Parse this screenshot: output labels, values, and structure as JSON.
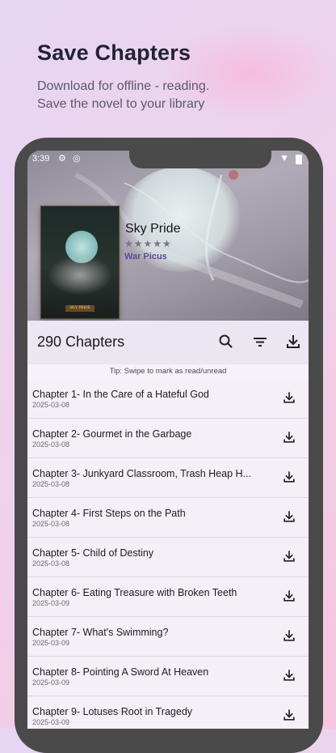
{
  "promo": {
    "headline": "Save Chapters",
    "subline_1": "Download for offline - reading.",
    "subline_2": "Save the novel to your library"
  },
  "status_bar": {
    "time": "3:39"
  },
  "book": {
    "title": "Sky Pride",
    "rating_stars": "★★★★★",
    "author": "War Picus",
    "cover_label": "SKY PRIDE"
  },
  "chapters_header": {
    "count_label": "290 Chapters"
  },
  "tip": "Tip: Swipe to mark as read/unread",
  "chapters": [
    {
      "title": "Chapter 1- In the Care of a Hateful God",
      "date": "2025-03-08"
    },
    {
      "title": "Chapter 2- Gourmet in the Garbage",
      "date": "2025-03-08"
    },
    {
      "title": "Chapter 3- Junkyard Classroom, Trash Heap H...",
      "date": "2025-03-08"
    },
    {
      "title": "Chapter 4- First Steps on the Path",
      "date": "2025-03-08"
    },
    {
      "title": "Chapter 5- Child of Destiny",
      "date": "2025-03-08"
    },
    {
      "title": "Chapter 6- Eating Treasure with Broken Teeth",
      "date": "2025-03-09"
    },
    {
      "title": "Chapter 7- What's Swimming?",
      "date": "2025-03-09"
    },
    {
      "title": "Chapter 8- Pointing A Sword At Heaven",
      "date": "2025-03-09"
    },
    {
      "title": "Chapter 9- Lotuses Root in Tragedy",
      "date": "2025-03-09"
    }
  ],
  "icons": {
    "search": "search-icon",
    "sort": "sort-icon",
    "download_all": "download-icon",
    "chapter_download": "download-icon"
  },
  "colors": {
    "accent": "#5a4aa0",
    "toolbar_bg": "#ece6f1",
    "list_bg": "#f5eff8"
  }
}
